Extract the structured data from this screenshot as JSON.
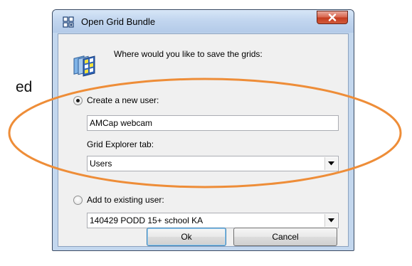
{
  "background": {
    "partial_text": "ed"
  },
  "dialog": {
    "title": "Open Grid Bundle",
    "prompt": "Where would you like to save the grids:",
    "close_symbol": "×",
    "options": {
      "new_user": {
        "label": "Create a new user:",
        "selected": true,
        "name_value": "AMCap webcam",
        "tab_label": "Grid Explorer tab:",
        "tab_value": "Users"
      },
      "existing_user": {
        "label": "Add to existing user:",
        "selected": false,
        "user_value": "140429 PODD 15+ school KA"
      }
    },
    "buttons": {
      "ok": "Ok",
      "cancel": "Cancel"
    }
  },
  "icons": {
    "title": "grid-bundle-icon",
    "prompt": "grid-pages-icon",
    "dropdown": "dropdown-arrow-icon",
    "close": "close-icon"
  },
  "colors": {
    "highlight": "#ee8d38",
    "close_button": "#c94428",
    "frame": "#c3d7ee"
  }
}
